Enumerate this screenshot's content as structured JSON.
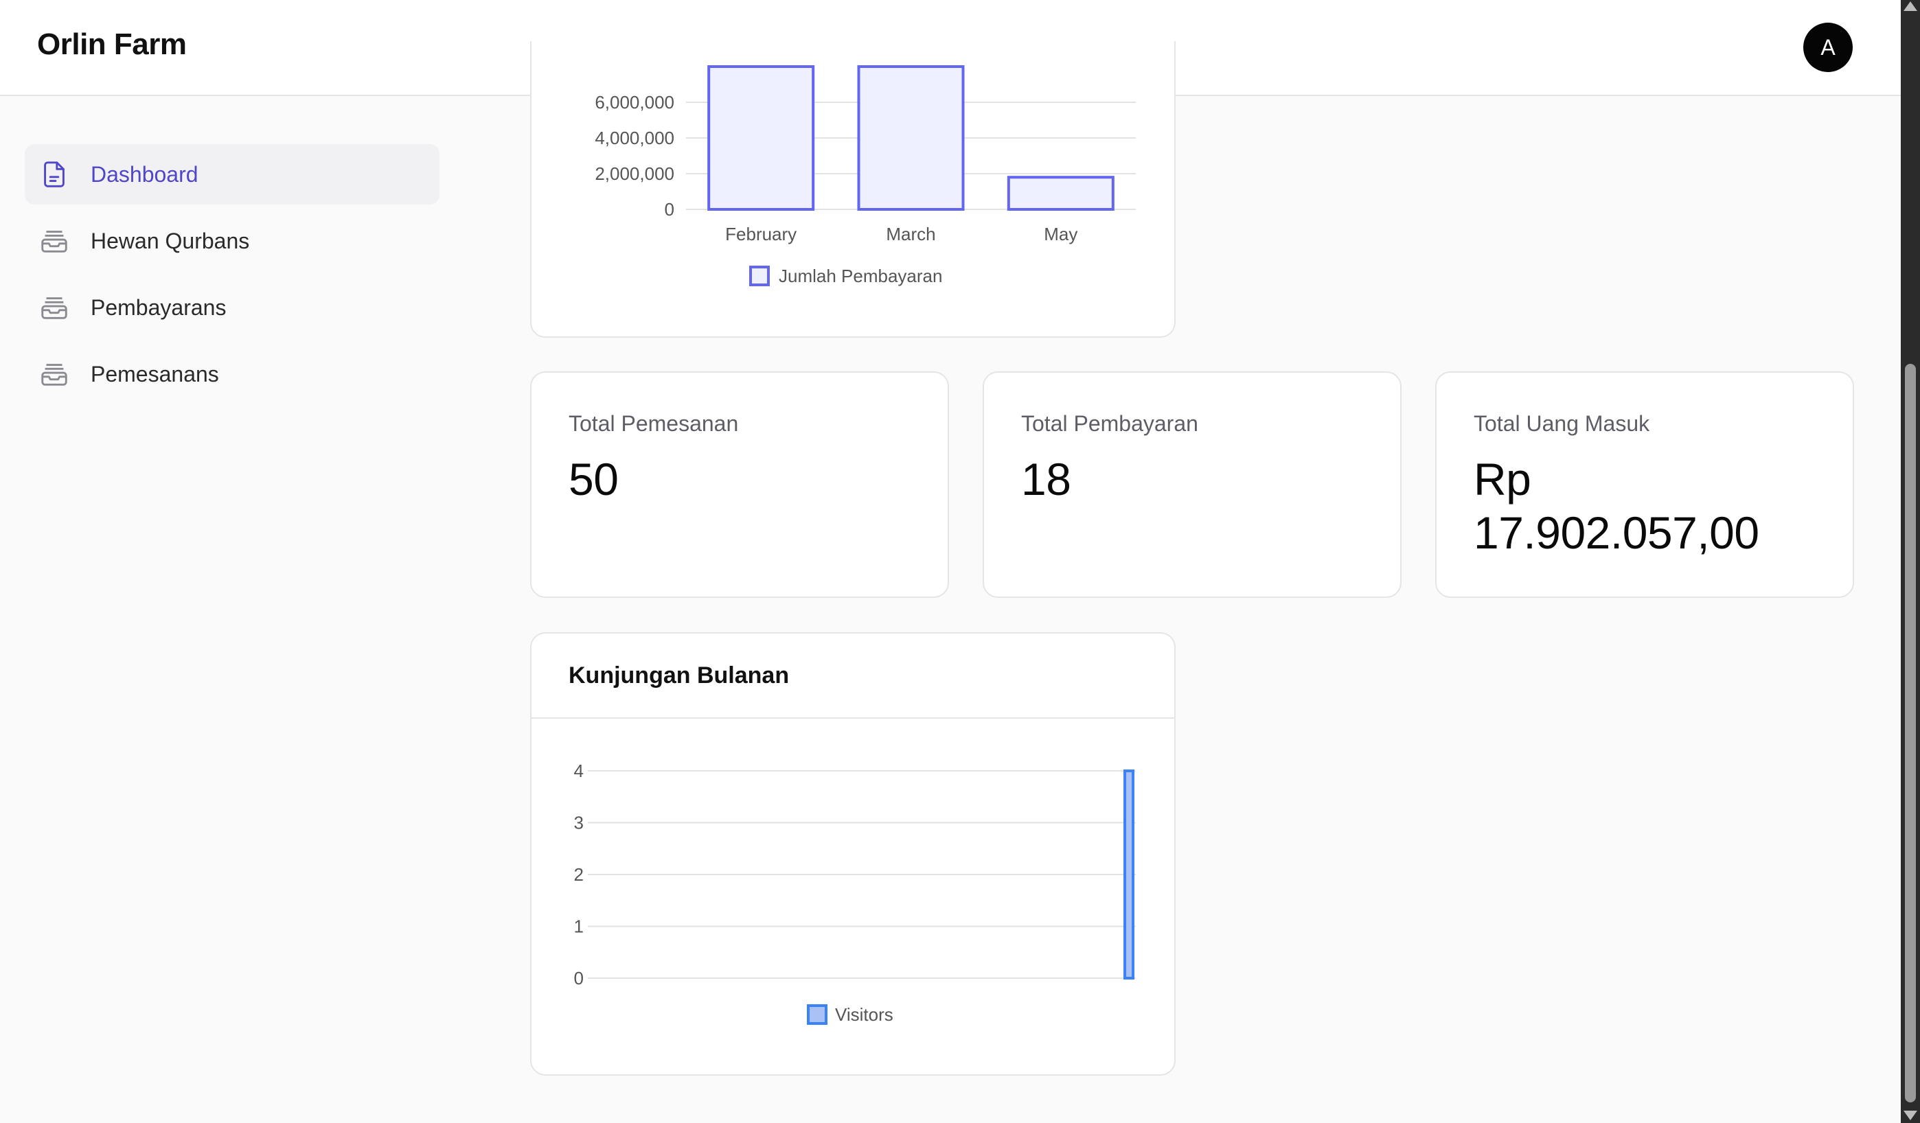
{
  "header": {
    "brand": "Orlin Farm",
    "avatar_initial": "A"
  },
  "sidebar": {
    "items": [
      {
        "label": "Dashboard",
        "icon": "document-icon",
        "active": true
      },
      {
        "label": "Hewan Qurbans",
        "icon": "inbox-stack-icon",
        "active": false
      },
      {
        "label": "Pembayarans",
        "icon": "inbox-stack-icon",
        "active": false
      },
      {
        "label": "Pemesanans",
        "icon": "inbox-stack-icon",
        "active": false
      }
    ]
  },
  "stats": [
    {
      "title": "Total Pemesanan",
      "value": "50"
    },
    {
      "title": "Total Pembayaran",
      "value": "18"
    },
    {
      "title": "Total Uang Masuk",
      "value_line1": "Rp",
      "value_line2": "17.902.057,00"
    }
  ],
  "payments_chart": {
    "chart_data": {
      "type": "bar",
      "categories": [
        "February",
        "March",
        "May"
      ],
      "series": [
        {
          "name": "Jumlah Pembayaran",
          "values": [
            8000000,
            8000000,
            1800000
          ]
        }
      ],
      "y_ticks": [
        "0",
        "2,000,000",
        "4,000,000",
        "6,000,000"
      ],
      "ylim": [
        0,
        6000000
      ],
      "legend": "bottom",
      "color": "#6366f1"
    }
  },
  "visits_chart": {
    "title": "Kunjungan Bulanan",
    "chart_data": {
      "type": "bar",
      "series": [
        {
          "name": "Visitors",
          "values": [
            4
          ]
        }
      ],
      "y_ticks": [
        "0",
        "1",
        "2",
        "3",
        "4"
      ],
      "ylim": [
        0,
        4
      ],
      "legend": "bottom",
      "color": "#3b82f6"
    }
  }
}
